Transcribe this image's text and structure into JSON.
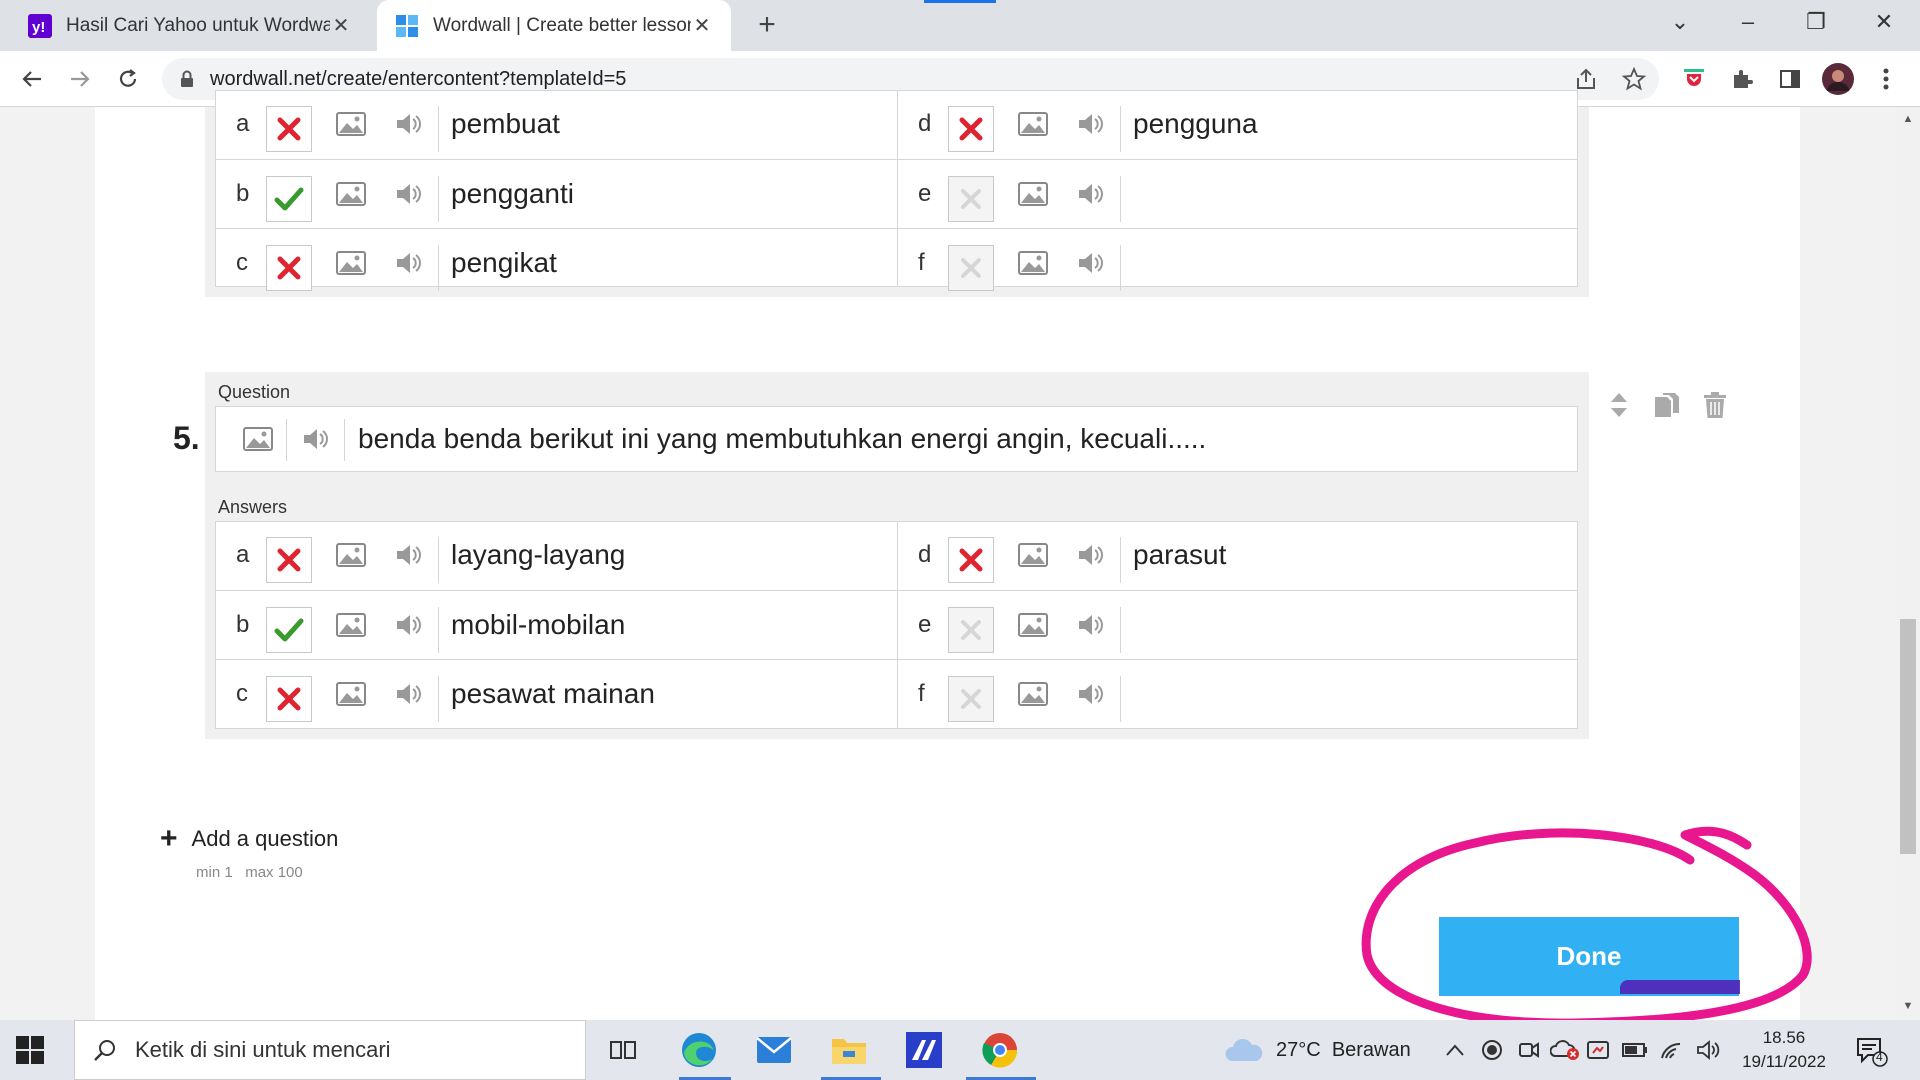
{
  "browser": {
    "tabs": [
      {
        "title": "Hasil Cari Yahoo untuk Wordwall",
        "active": false
      },
      {
        "title": "Wordwall | Create better lessons",
        "active": true
      }
    ],
    "new_tab": "+",
    "url": "wordwall.net/create/entercontent?templateId=5"
  },
  "question4": {
    "answers": [
      {
        "letter": "a",
        "state": "wrong",
        "text": "pembuat"
      },
      {
        "letter": "b",
        "state": "correct",
        "text": "pengganti"
      },
      {
        "letter": "c",
        "state": "wrong",
        "text": "pengikat"
      },
      {
        "letter": "d",
        "state": "wrong",
        "text": "pengguna"
      },
      {
        "letter": "e",
        "state": "empty",
        "text": ""
      },
      {
        "letter": "f",
        "state": "empty",
        "text": ""
      }
    ]
  },
  "question5": {
    "number": "5.",
    "question_label": "Question",
    "question_text": "benda benda berikut ini yang membutuhkan energi angin, kecuali.....",
    "answers_label": "Answers",
    "answers": [
      {
        "letter": "a",
        "state": "wrong",
        "text": "layang-layang"
      },
      {
        "letter": "b",
        "state": "correct",
        "text": "mobil-mobilan"
      },
      {
        "letter": "c",
        "state": "wrong",
        "text": "pesawat mainan"
      },
      {
        "letter": "d",
        "state": "wrong",
        "text": "parasut"
      },
      {
        "letter": "e",
        "state": "empty",
        "text": ""
      },
      {
        "letter": "f",
        "state": "empty",
        "text": ""
      }
    ]
  },
  "add_question": {
    "label": "Add a question",
    "min": "min 1",
    "max": "max 100"
  },
  "done_label": "Done",
  "taskbar": {
    "search_placeholder": "Ketik di sini untuk mencari",
    "weather_temp": "27°C",
    "weather_text": "Berawan",
    "time": "18.56",
    "date": "19/11/2022",
    "notification_count": "4"
  },
  "colors": {
    "done": "#31b0f4",
    "highlight_circle": "#e8168f",
    "correct": "#3a9a2e",
    "wrong": "#e0242f"
  }
}
